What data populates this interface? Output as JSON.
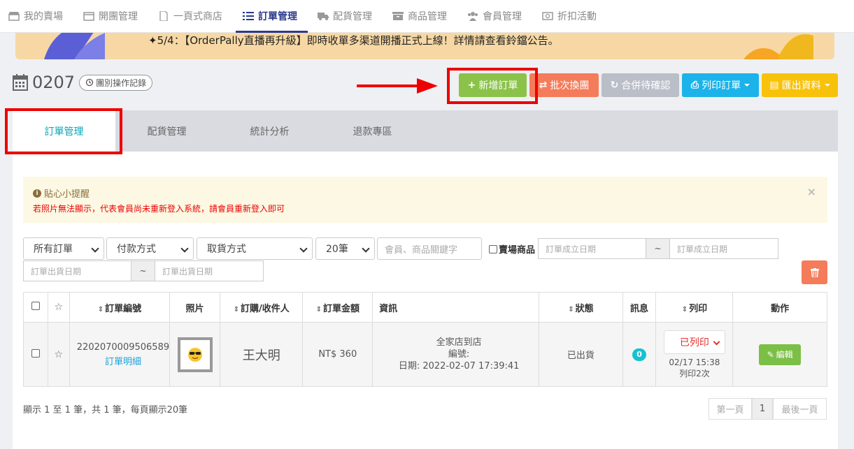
{
  "nav": {
    "items": [
      {
        "label": "我的賣場",
        "icon": "store-icon"
      },
      {
        "label": "開團管理",
        "icon": "calendar-icon"
      },
      {
        "label": "一頁式商店",
        "icon": "file-icon"
      },
      {
        "label": "訂單管理",
        "icon": "list-icon",
        "active": true
      },
      {
        "label": "配貨管理",
        "icon": "truck-icon"
      },
      {
        "label": "商品管理",
        "icon": "archive-icon"
      },
      {
        "label": "會員管理",
        "icon": "users-icon"
      },
      {
        "label": "折扣活動",
        "icon": "money-icon"
      }
    ]
  },
  "banner": {
    "text": "✦5/4：【OrderPally直播再升級】即時收單多渠道開播正式上線！詳情請查看鈴鐺公告。"
  },
  "order": {
    "number": "0207",
    "log_label": "團別操作記錄"
  },
  "actions": {
    "new_order": "新增訂單",
    "batch": "批次換團",
    "merge": "合併待確認",
    "print": "列印訂單",
    "export": "匯出資料"
  },
  "tabs": [
    "訂單管理",
    "配貨管理",
    "統計分析",
    "退款專區"
  ],
  "alert": {
    "title": "貼心小提醒",
    "message": "若照片無法顯示，代表會員尚未重新登入系統，請會員重新登入即可",
    "close": "×"
  },
  "filters": {
    "order_type": "所有訂單",
    "payment": "付款方式",
    "pickup": "取貨方式",
    "page_size": "20筆",
    "keyword_placeholder": "會員、商品關鍵字",
    "store_products": "賣場商品",
    "created_from": "訂單成立日期",
    "created_to": "訂單成立日期",
    "ship_from": "訂單出貨日期",
    "ship_to": "訂單出貨日期",
    "tilde": "~"
  },
  "table": {
    "headers": {
      "order_no": "訂單編號",
      "photo": "照片",
      "buyer": "訂購/收件人",
      "amount": "訂單金額",
      "info": "資訊",
      "status": "狀態",
      "message": "訊息",
      "print": "列印",
      "action": "動作"
    },
    "rows": [
      {
        "order_no": "2202070009506589",
        "detail_link": "訂單明細",
        "buyer": "王大明",
        "amount": "NT$ 360",
        "info_line1": "全家店到店",
        "info_line2": "編號:",
        "info_line3": "日期: 2022-02-07 17:39:41",
        "status": "已出貨",
        "message_count": "0",
        "print_status": "已列印",
        "print_time": "02/17 15:38",
        "print_count": "列印2次",
        "edit": "編輯"
      }
    ]
  },
  "footer": {
    "summary": "顯示 1 至 1 筆，共 1 筆，每頁顯示20筆",
    "first": "第一頁",
    "current": "1",
    "last": "最後一頁"
  }
}
